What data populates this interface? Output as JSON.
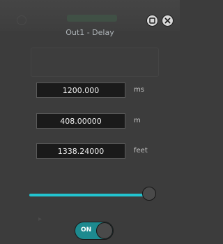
{
  "window": {
    "title": "Out1 - Delay"
  },
  "fields": {
    "ms": {
      "value": "1200.000",
      "unit": "ms"
    },
    "meters": {
      "value": "408.00000",
      "unit": "m"
    },
    "feet": {
      "value": "1338.24000",
      "unit": "feet"
    }
  },
  "slider": {
    "level_percent": 100
  },
  "toggle": {
    "label": "ON",
    "state": "on"
  },
  "colors": {
    "accent": "#22c4d0",
    "toggle_on": "#1d8a8f",
    "background": "#3c3c3c"
  },
  "icons": {
    "restore": "restore-icon",
    "close": "close-icon"
  }
}
